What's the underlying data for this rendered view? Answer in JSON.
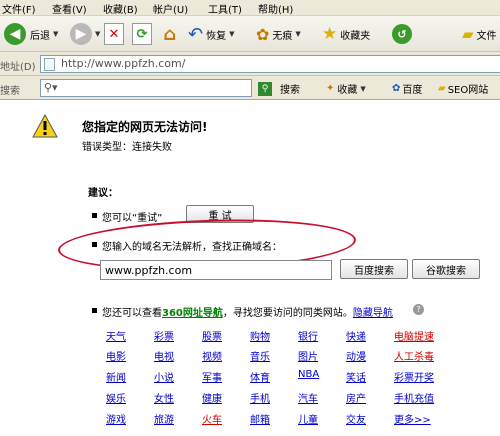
{
  "menubar": [
    "文件(F)",
    "查看(V)",
    "收藏(B)",
    "帐户(U)",
    "工具(T)",
    "帮助(H)"
  ],
  "toolbar": {
    "back_label": "后退",
    "restore_label": "恢复",
    "notrace_label": "无痕",
    "favorites_label": "收藏夹",
    "folder_label": "文件"
  },
  "address": {
    "label": "地址(D)",
    "url": "http://www.ppfzh.com/"
  },
  "searchbar": {
    "label": "搜索",
    "search_button": "搜索",
    "collect_label": "收藏",
    "baidu_label": "百度",
    "seo_label": "SEO网站"
  },
  "error": {
    "title": "您指定的网页无法访问!",
    "type": "错误类型：连接失败"
  },
  "suggest": {
    "title": "建议：",
    "retry_text": "您可以“重试”",
    "retry_button": "重 试",
    "resolve_text": "您输入的域名无法解析，查找正确域名：",
    "domain_value": "www.ppfzh.com",
    "baidu_button": "百度搜索",
    "google_button": "谷歌搜索",
    "nav_prefix": "您还可以查看",
    "nav_link": "360网址导航",
    "nav_suffix": "，寻找您要访问的同类网站。",
    "hide_link": "隐藏导航"
  },
  "links": [
    [
      "天气",
      "彩票",
      "股票",
      "购物",
      "银行",
      "快递",
      "电脑提速"
    ],
    [
      "电影",
      "电视",
      "视频",
      "音乐",
      "图片",
      "动漫",
      "人工杀毒"
    ],
    [
      "新闻",
      "小说",
      "军事",
      "体育",
      "NBA",
      "笑话",
      "彩票开奖"
    ],
    [
      "娱乐",
      "女性",
      "健康",
      "手机",
      "汽车",
      "房产",
      "手机充值"
    ],
    [
      "游戏",
      "旅游",
      "火车",
      "邮箱",
      "儿童",
      "交友",
      "更多>>"
    ]
  ],
  "colors": {
    "accent_red": "#c8102e",
    "link_blue": "#0000cc",
    "link_red": "#cc0000",
    "nav_green": "#008000"
  }
}
